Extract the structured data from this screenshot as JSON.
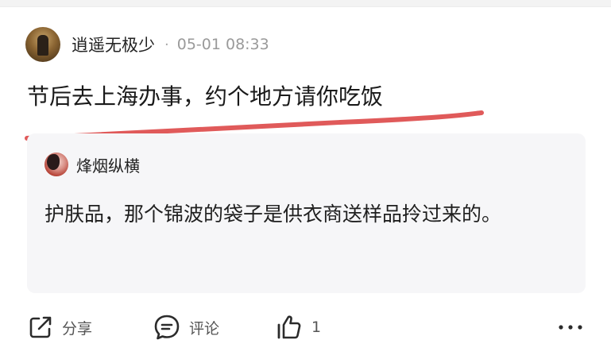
{
  "post": {
    "author": "逍遥无极少",
    "separator": "·",
    "timestamp": "05-01 08:33",
    "content": "节后去上海办事，约个地方请你吃饭"
  },
  "quoted": {
    "author": "烽烟纵横",
    "content": "护肤品，那个锦波的袋子是供衣商送样品拎过来的。"
  },
  "actions": {
    "share_label": "分享",
    "comment_label": "评论",
    "like_count": "1"
  },
  "annotation_color": "#e05a5a"
}
